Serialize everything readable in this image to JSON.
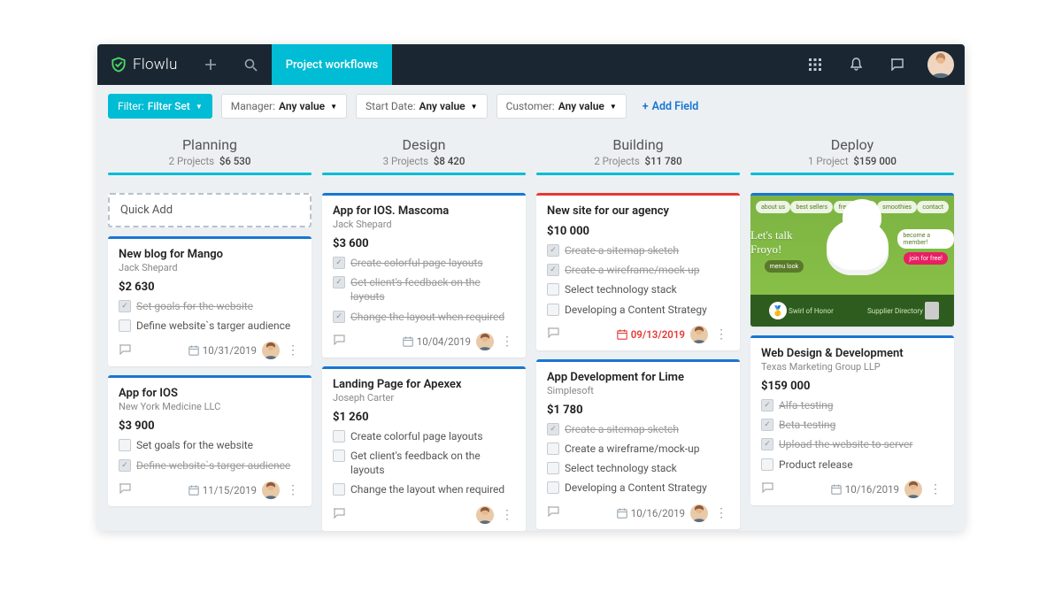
{
  "app": {
    "name": "Flowlu"
  },
  "topbar": {
    "active_tab": "Project workflows"
  },
  "filters": {
    "filter": {
      "label": "Filter:",
      "value": "Filter Set"
    },
    "manager": {
      "label": "Manager:",
      "value": "Any value"
    },
    "start_date": {
      "label": "Start Date:",
      "value": "Any value"
    },
    "customer": {
      "label": "Customer:",
      "value": "Any value"
    },
    "add_field": "Add Field"
  },
  "columns": [
    {
      "title": "Planning",
      "count": "2 Projects",
      "total": "$6 530"
    },
    {
      "title": "Design",
      "count": "3 Projects",
      "total": "$8 420"
    },
    {
      "title": "Building",
      "count": "2 Projects",
      "total": "$11 780"
    },
    {
      "title": "Deploy",
      "count": "1 Project",
      "total": "$159 000"
    }
  ],
  "quick_add": "Quick Add",
  "planning_cards": [
    {
      "title": "New blog for Mango",
      "sub": "Jack Shepard",
      "price": "$2 630",
      "tasks": [
        {
          "label": "Set goals for the website",
          "done": true
        },
        {
          "label": "Define website`s targer audience",
          "done": false
        }
      ],
      "date": "10/31/2019"
    },
    {
      "title": "App for IOS",
      "sub": "New York Medicine LLC",
      "price": "$3 900",
      "tasks": [
        {
          "label": "Set goals for the website",
          "done": false
        },
        {
          "label": "Define website`s targer audience",
          "done": true
        }
      ],
      "date": "11/15/2019"
    }
  ],
  "design_cards": [
    {
      "title": "App for IOS. Mascoma",
      "sub": "Jack Shepard",
      "price": "$3 600",
      "tasks": [
        {
          "label": "Create colorful page layouts",
          "done": true
        },
        {
          "label": "Get client's feedback on the layouts",
          "done": true
        },
        {
          "label": "Change the layout when required",
          "done": true
        }
      ],
      "date": "10/04/2019"
    },
    {
      "title": "Landing Page for Apexex",
      "sub": "Joseph Carter",
      "price": "$1 260",
      "tasks": [
        {
          "label": "Create colorful page layouts",
          "done": false
        },
        {
          "label": "Get client's feedback on the layouts",
          "done": false
        },
        {
          "label": "Change the layout when required",
          "done": false
        }
      ],
      "date": ""
    }
  ],
  "building_cards": [
    {
      "title": "New site for our agency",
      "sub": "",
      "price": "$10 000",
      "red": true,
      "tasks": [
        {
          "label": "Create a sitemap sketch",
          "done": true
        },
        {
          "label": "Create a wireframe/mock-up",
          "done": true
        },
        {
          "label": "Select technology stack",
          "done": false
        },
        {
          "label": "Developing a Content Strategy",
          "done": false
        }
      ],
      "date": "09/13/2019",
      "alert": true
    },
    {
      "title": "App Development for Lime",
      "sub": "Simplesoft",
      "price": "$1 780",
      "tasks": [
        {
          "label": "Create a sitemap sketch",
          "done": true
        },
        {
          "label": "Create a wireframe/mock-up",
          "done": false
        },
        {
          "label": "Select technology stack",
          "done": false
        },
        {
          "label": "Developing a Content Strategy",
          "done": false
        }
      ],
      "date": "10/16/2019"
    }
  ],
  "deploy_card": {
    "title": "Web Design & Development",
    "sub": "Texas Marketing Group LLP",
    "price": "$159 000",
    "tasks": [
      {
        "label": "Alfa-testing",
        "done": true
      },
      {
        "label": "Beta-testing",
        "done": true
      },
      {
        "label": "Upload the website to server",
        "done": true
      },
      {
        "label": "Product release",
        "done": false
      }
    ],
    "date": "10/16/2019",
    "promo": {
      "chips": [
        "about us",
        "best sellers",
        "fresh cream",
        "smoothies",
        "contact"
      ],
      "slogan": "Let's talk Froyo!",
      "right_badge": "become a member!",
      "btn1": "menu look",
      "btn2": "join for free!",
      "foot1": "Swirl of Honor",
      "foot2": "Supplier Directory"
    }
  }
}
